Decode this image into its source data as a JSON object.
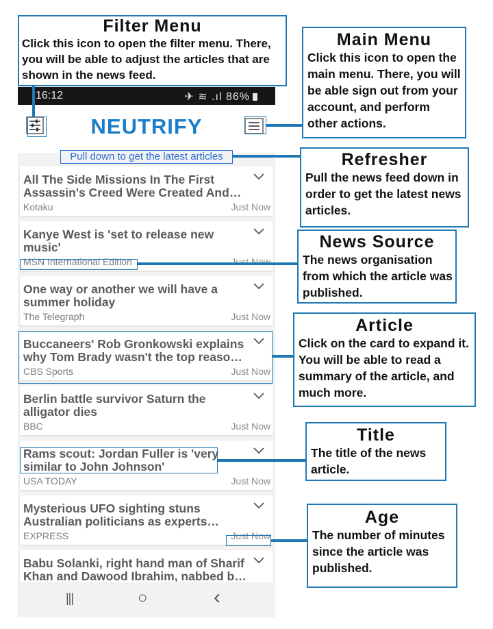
{
  "status_bar": {
    "time": "16:12",
    "signal_icons": "✈ ≋ .ıl",
    "battery": "86%"
  },
  "app_bar": {
    "title": "NEUTRIFY"
  },
  "refresher_text": "Pull down to get the latest articles",
  "articles": [
    {
      "title": "All The Side Missions In The First Assassin's Creed Were Created And Implemented In One Week",
      "source": "Kotaku",
      "age": "Just Now"
    },
    {
      "title": "Kanye West is 'set to release new music'",
      "source": "MSN International Edition",
      "age": "Just Now"
    },
    {
      "title": "One way or another we will have a summer holiday",
      "source": "The Telegraph",
      "age": "Just Now"
    },
    {
      "title": "Buccaneers' Rob Gronkowski explains why Tom Brady wasn't the top reason for his return",
      "source": "CBS Sports",
      "age": "Just Now"
    },
    {
      "title": "Berlin battle survivor Saturn the alligator dies",
      "source": "BBC",
      "age": "Just Now"
    },
    {
      "title": "Rams scout: Jordan Fuller is 'very similar to John Johnson'",
      "source": "USA TODAY",
      "age": "Just Now"
    },
    {
      "title": "Mysterious UFO sighting stuns Australian politicians as experts investigate",
      "source": "EXPRESS",
      "age": "Just Now"
    },
    {
      "title": "Babu Solanki, right hand man of Sharif Khan and Dawood Ibrahim, nabbed by police",
      "source": "",
      "age": ""
    }
  ],
  "nav_bar": {
    "recents": "|||",
    "home": "○",
    "back": "‹"
  },
  "callouts": {
    "filter_menu": {
      "heading": "Filter Menu",
      "body": "Click this icon to open the filter menu. There, you will be able to adjust the articles that are shown in the news feed."
    },
    "main_menu": {
      "heading": "Main Menu",
      "body": "Click this icon to open the main menu. There, you will be able sign out from your account, and perform other actions."
    },
    "refresher": {
      "heading": "Refresher",
      "body": "Pull the news feed down in order to get the latest news articles."
    },
    "news_source": {
      "heading": "News Source",
      "body": "The news organisation from which the article was published."
    },
    "article": {
      "heading": "Article",
      "body": "Click on the card to expand it. You will be able to read a summary of the article, and much more."
    },
    "title": {
      "heading": "Title",
      "body": "The title of the news article."
    },
    "age": {
      "heading": "Age",
      "body": "The number of minutes since the article was published."
    }
  },
  "icons": {
    "filter": "sliders-icon",
    "menu": "hamburger-icon",
    "expand": "chevron-down-icon"
  },
  "colors": {
    "brand": "#1c7ec8",
    "callout_border": "#1f78b4",
    "highlight": "#2a6ed1"
  }
}
